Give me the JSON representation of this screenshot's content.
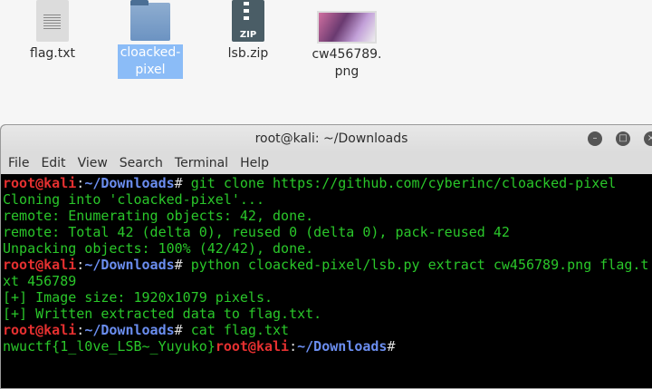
{
  "desktop": {
    "icons": [
      {
        "label": "flag.txt",
        "type": "text-file"
      },
      {
        "label": "cloacked-\npixel",
        "type": "folder",
        "selected": true
      },
      {
        "label": "lsb.zip",
        "type": "zip",
        "badge": "ZIP"
      },
      {
        "label": "cw456789.\npng",
        "type": "image"
      }
    ]
  },
  "terminal": {
    "title": "root@kali: ~/Downloads",
    "menu": [
      "File",
      "Edit",
      "View",
      "Search",
      "Terminal",
      "Help"
    ],
    "prompt_user": "root@kali",
    "prompt_path": "~/Downloads",
    "lines": [
      {
        "cmd": "git clone https://github.com/cyberinc/cloacked-pixel"
      },
      {
        "text": "Cloning into 'cloacked-pixel'..."
      },
      {
        "text": "remote: Enumerating objects: 42, done."
      },
      {
        "text": "remote: Total 42 (delta 0), reused 0 (delta 0), pack-reused 42"
      },
      {
        "text": "Unpacking objects: 100% (42/42), done."
      },
      {
        "cmd": "python cloacked-pixel/lsb.py extract cw456789.png flag.txt 456789"
      },
      {
        "text": "[+] Image size: 1920x1079 pixels."
      },
      {
        "text": "[+] Written extracted data to flag.txt."
      },
      {
        "cmd": "cat flag.txt"
      },
      {
        "text": "nwuctf{1_l0ve_LSB~_Yuyuko}"
      }
    ]
  }
}
